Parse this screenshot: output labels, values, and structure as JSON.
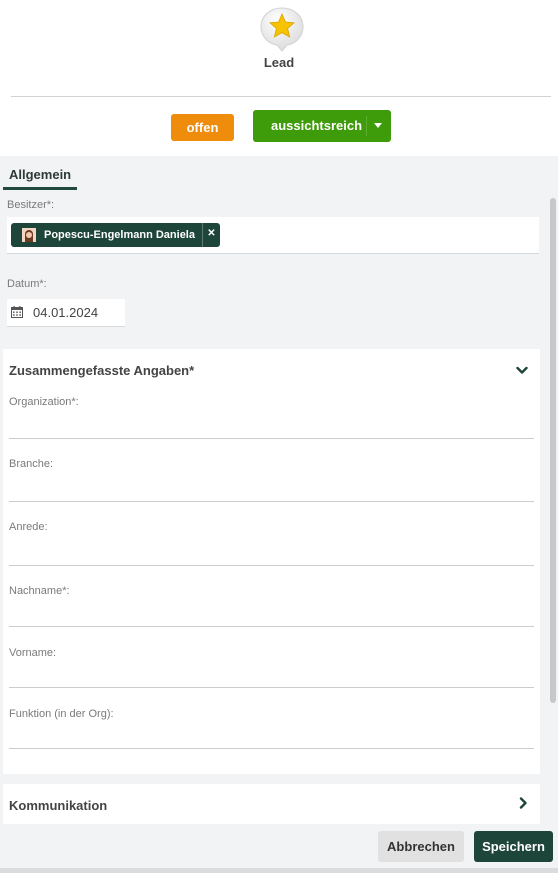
{
  "header": {
    "title": "Lead",
    "status_offen_label": "offen",
    "status_aussicht_label": "aussichtsreich",
    "icon": "star-badge-icon"
  },
  "tabs": [
    {
      "label": "Allgemein",
      "active": true
    }
  ],
  "fields": {
    "owner": {
      "label": "Besitzer*:",
      "value": "Popescu-Engelmann Daniela"
    },
    "date": {
      "label": "Datum*:",
      "value": "04.01.2024"
    }
  },
  "section_summary": {
    "title": "Zusammengefasste Angaben*",
    "fields": [
      {
        "label": "Organization*:",
        "value": ""
      },
      {
        "label": "Branche:",
        "value": ""
      },
      {
        "label": "Anrede:",
        "value": ""
      },
      {
        "label": "Nachname*:",
        "value": ""
      },
      {
        "label": "Vorname:",
        "value": ""
      },
      {
        "label": "Funktion (in der Org):",
        "value": ""
      }
    ]
  },
  "section_communication": {
    "title": "Kommunikation"
  },
  "footer": {
    "cancel_label": "Abbrechen",
    "save_label": "Speichern"
  },
  "colors": {
    "offen": "#f08c0b",
    "aussichtsreich": "#3e9b0a",
    "primary": "#1e4539"
  }
}
